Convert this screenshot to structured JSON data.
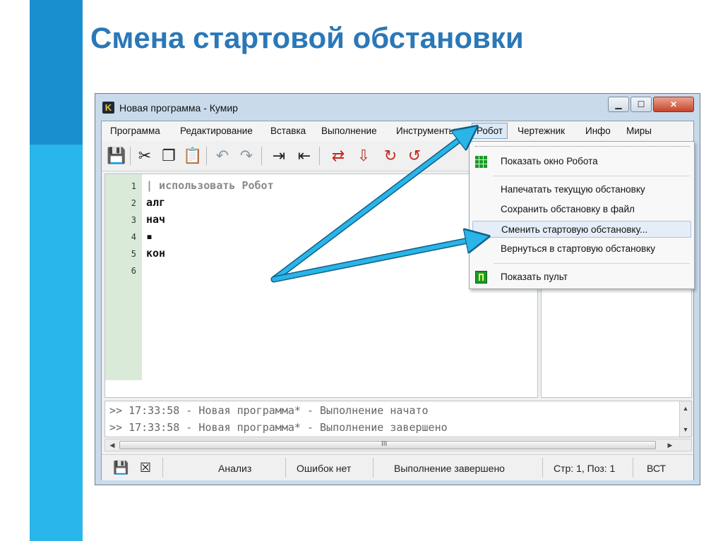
{
  "slide": {
    "title": "Смена стартовой обстановки"
  },
  "window": {
    "icon_letter": "K",
    "title": "Новая программа - Кумир",
    "controls": {
      "minimize": "▁",
      "maximize": "☐",
      "close": "✕"
    }
  },
  "menubar": [
    {
      "label": "Программа"
    },
    {
      "label": "Редактирование"
    },
    {
      "label": "Вставка"
    },
    {
      "label": "Выполнение"
    },
    {
      "label": "Инструменты"
    },
    {
      "label": "Робот"
    },
    {
      "label": "Чертежник"
    },
    {
      "label": "Инфо"
    },
    {
      "label": "Миры"
    }
  ],
  "toolbar": [
    {
      "icon": "save-icon",
      "glyph": "💾"
    },
    {
      "icon": "cut-icon",
      "glyph": "✂"
    },
    {
      "icon": "copy-icon",
      "glyph": "❐"
    },
    {
      "icon": "paste-icon",
      "glyph": "📋"
    },
    {
      "icon": "undo-icon",
      "glyph": "↶"
    },
    {
      "icon": "redo-icon",
      "glyph": "↷"
    },
    {
      "icon": "indent-icon",
      "glyph": "⇥"
    },
    {
      "icon": "unindent-icon",
      "glyph": "⇤"
    },
    {
      "icon": "run-icon",
      "glyph": "⇄"
    },
    {
      "icon": "step-icon",
      "glyph": "⇩"
    },
    {
      "icon": "step-into-icon",
      "glyph": "↻"
    },
    {
      "icon": "step-out-icon",
      "glyph": "↺"
    }
  ],
  "editor": {
    "line_numbers": [
      "1",
      "2",
      "3",
      "4",
      "5",
      "6"
    ],
    "lines": [
      "| использовать Робот",
      "алг",
      "нач",
      "▪",
      "кон",
      ""
    ]
  },
  "output": {
    "lines": [
      ">> 17:33:58 - Новая программа* - Выполнение начато",
      ">> 17:33:58 - Новая программа* - Выполнение завершено"
    ]
  },
  "scroll": {
    "grip": "III"
  },
  "statusbar": {
    "analysis": "Анализ",
    "errors": "Ошибок нет",
    "state": "Выполнение завершено",
    "position": "Стр: 1, Поз: 1",
    "mode": "ВСТ"
  },
  "robot_menu": [
    {
      "label": "Показать окно Робота",
      "icon": "grid-icon"
    },
    {
      "label": "Напечатать текущую обстановку"
    },
    {
      "label": "Сохранить обстановку в файл"
    },
    {
      "label": "Сменить стартовую обстановку...",
      "highlighted": true
    },
    {
      "label": "Вернуться в стартовую обстановку"
    },
    {
      "label": "Показать пульт",
      "icon": "panel-icon"
    }
  ],
  "colors": {
    "accent_blue": "#2a78b8",
    "arrow_cyan": "#2ab4e8",
    "side_bar": "#1a8fcf"
  }
}
